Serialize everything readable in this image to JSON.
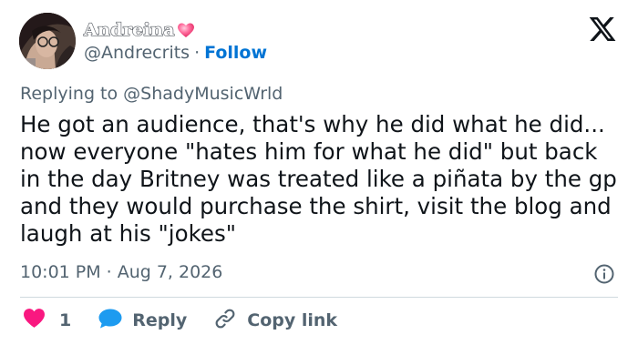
{
  "author": {
    "display_name": "Andreina",
    "handle": "@Andrecrits",
    "separator": "·",
    "follow_label": "Follow",
    "verified_emoji": "heart-emoji"
  },
  "reply_context": {
    "prefix": "Replying to",
    "target": "@ShadyMusicWrld"
  },
  "tweet": {
    "text": "He got an audience, that's why he did what he did... now everyone \"hates him for what he did\" but back in the day Britney was treated like a piñata by the gp and they would purchase the shirt, visit the blog and laugh at his \"jokes\"",
    "time": "10:01 PM",
    "separator": "·",
    "date": "Aug 7, 2026"
  },
  "actions": {
    "like_count": "1",
    "reply_label": "Reply",
    "copy_label": "Copy link"
  },
  "colors": {
    "like_red": "#f91880",
    "reply_blue": "#1d9bf0",
    "follow_blue": "#0074d4",
    "muted_text": "#536471"
  },
  "icons": [
    "x-logo-icon",
    "heart-icon",
    "reply-bubble-icon",
    "link-icon",
    "info-icon"
  ]
}
